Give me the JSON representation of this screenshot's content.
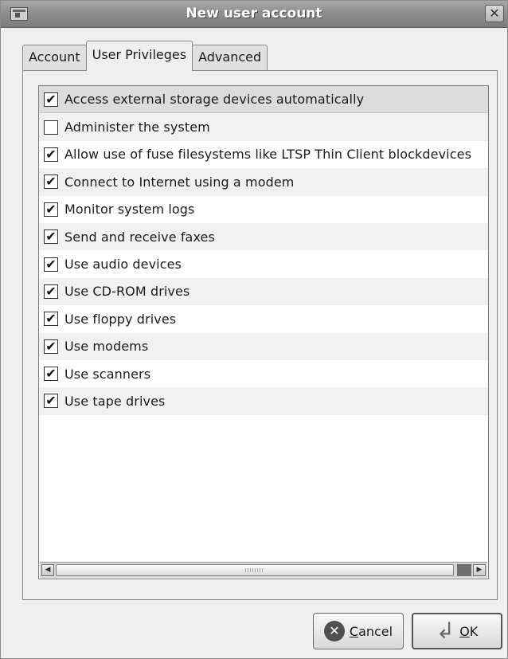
{
  "window": {
    "title": "New user account",
    "close_glyph": "✕"
  },
  "tabs": [
    {
      "label": "Account",
      "active": false
    },
    {
      "label": "User Privileges",
      "active": true
    },
    {
      "label": "Advanced",
      "active": false
    }
  ],
  "privileges": [
    {
      "label": "Access external storage devices automatically",
      "checked": true
    },
    {
      "label": "Administer the system",
      "checked": false
    },
    {
      "label": "Allow use of fuse filesystems like LTSP Thin Client blockdevices",
      "checked": true
    },
    {
      "label": "Connect to Internet using a modem",
      "checked": true
    },
    {
      "label": "Monitor system logs",
      "checked": true
    },
    {
      "label": "Send and receive faxes",
      "checked": true
    },
    {
      "label": "Use audio devices",
      "checked": true
    },
    {
      "label": "Use CD-ROM drives",
      "checked": true
    },
    {
      "label": "Use floppy drives",
      "checked": true
    },
    {
      "label": "Use modems",
      "checked": true
    },
    {
      "label": "Use scanners",
      "checked": true
    },
    {
      "label": "Use tape drives",
      "checked": true
    }
  ],
  "selected_index": 0,
  "buttons": {
    "cancel": {
      "mnemonic": "C",
      "rest": "ancel",
      "icon": "cancel-icon"
    },
    "ok": {
      "mnemonic": "O",
      "rest": "K",
      "icon": "enter-arrow-icon"
    }
  },
  "glyphs": {
    "check": "✔",
    "scroll_left": "◀",
    "scroll_right": "▶",
    "cancel_x": "✕",
    "ok_arrow": "↲"
  }
}
